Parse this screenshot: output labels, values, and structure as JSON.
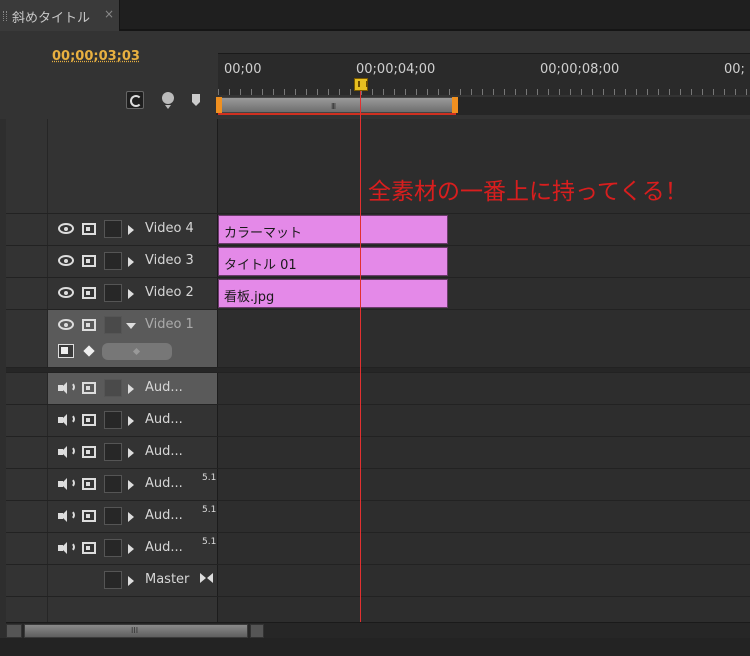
{
  "tab": {
    "title": "斜めタイトル",
    "close": "×"
  },
  "timecode": "00;00;03;03",
  "ruler": {
    "labels": [
      "00;00",
      "00;00;04;00",
      "00;00;08;00",
      "00;"
    ]
  },
  "workarea": {
    "grip": "III"
  },
  "annotation": "全素材の一番上に持ってくる！",
  "tracks": {
    "video4": {
      "name": "Video 4",
      "clip": "カラーマット"
    },
    "video3": {
      "name": "Video 3",
      "clip": "タイトル 01"
    },
    "video2": {
      "name": "Video 2",
      "clip": "看板.jpg"
    },
    "video1": {
      "name": "Video 1"
    },
    "audio": [
      {
        "name": "Aud..."
      },
      {
        "name": "Aud..."
      },
      {
        "name": "Aud..."
      },
      {
        "name": "Aud...",
        "badge": "5.1"
      },
      {
        "name": "Aud...",
        "badge": "5.1"
      },
      {
        "name": "Aud...",
        "badge": "5.1"
      }
    ],
    "master": {
      "name": "Master"
    }
  },
  "scrollbar": {
    "grip": "III"
  },
  "colors": {
    "clip": "#e489e8",
    "playhead": "#e23030",
    "timecode": "#e8b040",
    "annotation": "#d81e1e"
  }
}
